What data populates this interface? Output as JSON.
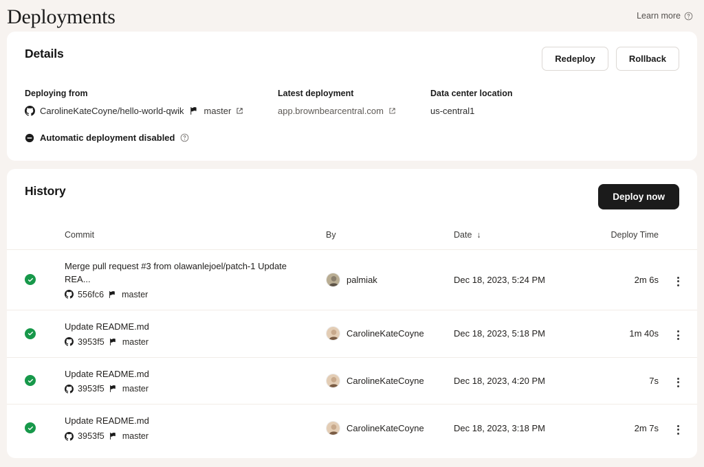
{
  "header": {
    "title": "Deployments",
    "learn_more": "Learn more",
    "help_icon": "question-circle-icon"
  },
  "details": {
    "title": "Details",
    "redeploy_label": "Redeploy",
    "rollback_label": "Rollback",
    "deploying_from": {
      "label": "Deploying from",
      "repo": "CarolineKateCoyne/hello-world-qwik",
      "branch": "master",
      "repo_icon": "github-icon",
      "branch_icon": "git-branch-icon",
      "external_icon": "external-link-icon"
    },
    "latest_deployment": {
      "label": "Latest deployment",
      "url": "app.brownbearcentral.com",
      "external_icon": "external-link-icon"
    },
    "data_center": {
      "label": "Data center location",
      "value": "us-central1"
    },
    "auto_deploy": {
      "status_icon": "minus-circle-icon",
      "text": "Automatic deployment disabled",
      "help_icon": "question-circle-icon"
    }
  },
  "history": {
    "title": "History",
    "deploy_now_label": "Deploy now",
    "columns": {
      "commit": "Commit",
      "by": "By",
      "date": "Date",
      "date_sort_icon": "arrow-down-icon",
      "deploy_time": "Deploy Time"
    },
    "rows": [
      {
        "status": "success",
        "status_icon": "check-circle-icon",
        "message": "Merge pull request #3 from olawanlejoel/patch-1 Update REA...",
        "sha": "556fc6",
        "branch": "master",
        "by": "palmiak",
        "date": "Dec 18, 2023, 5:24 PM",
        "deploy_time": "2m 6s",
        "menu_icon": "kebab-menu-icon"
      },
      {
        "status": "success",
        "status_icon": "check-circle-icon",
        "message": "Update README.md",
        "sha": "3953f5",
        "branch": "master",
        "by": "CarolineKateCoyne",
        "date": "Dec 18, 2023, 5:18 PM",
        "deploy_time": "1m 40s",
        "menu_icon": "kebab-menu-icon"
      },
      {
        "status": "success",
        "status_icon": "check-circle-icon",
        "message": "Update README.md",
        "sha": "3953f5",
        "branch": "master",
        "by": "CarolineKateCoyne",
        "date": "Dec 18, 2023, 4:20 PM",
        "deploy_time": "7s",
        "menu_icon": "kebab-menu-icon"
      },
      {
        "status": "success",
        "status_icon": "check-circle-icon",
        "message": "Update README.md",
        "sha": "3953f5",
        "branch": "master",
        "by": "CarolineKateCoyne",
        "date": "Dec 18, 2023, 3:18 PM",
        "deploy_time": "2m 7s",
        "menu_icon": "kebab-menu-icon"
      }
    ]
  },
  "colors": {
    "page_background": "#f7f3f0",
    "card_background": "#ffffff",
    "success": "#17984a",
    "primary_button": "#1b1b1b",
    "divider": "#f1ece7"
  }
}
